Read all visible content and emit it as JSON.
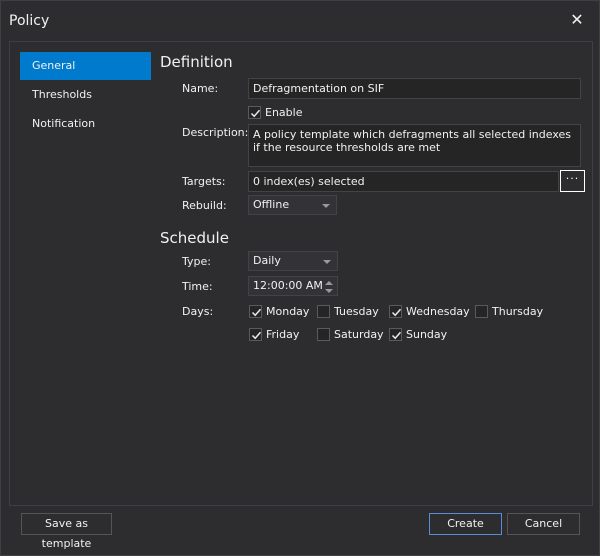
{
  "window": {
    "title": "Policy"
  },
  "nav": {
    "items": [
      {
        "label": "General"
      },
      {
        "label": "Thresholds"
      },
      {
        "label": "Notification"
      }
    ]
  },
  "definition": {
    "title": "Definition",
    "name_label": "Name:",
    "name_value": "Defragmentation on SIF",
    "enable_label": "Enable",
    "enable_checked": true,
    "description_label": "Description:",
    "description_value": "A policy template which defragments all selected indexes if the resource thresholds are met",
    "targets_label": "Targets:",
    "targets_value": "0 index(es) selected",
    "targets_button": "···",
    "rebuild_label": "Rebuild:",
    "rebuild_value": "Offline"
  },
  "schedule": {
    "title": "Schedule",
    "type_label": "Type:",
    "type_value": "Daily",
    "time_label": "Time:",
    "time_value": "12:00:00 AM",
    "days_label": "Days:",
    "days": [
      {
        "label": "Monday",
        "checked": true
      },
      {
        "label": "Tuesday",
        "checked": false
      },
      {
        "label": "Wednesday",
        "checked": true
      },
      {
        "label": "Thursday",
        "checked": false
      },
      {
        "label": "Friday",
        "checked": true
      },
      {
        "label": "Saturday",
        "checked": false
      },
      {
        "label": "Sunday",
        "checked": true
      }
    ]
  },
  "footer": {
    "save_template": "Save as template",
    "create": "Create",
    "cancel": "Cancel"
  },
  "colors": {
    "background": "#2d2d30",
    "accent": "#007acc",
    "input_bg": "#252526",
    "border": "#434346"
  },
  "icons": {
    "close": "close-icon",
    "check": "check-icon",
    "dropdown": "chevron-down-icon"
  }
}
